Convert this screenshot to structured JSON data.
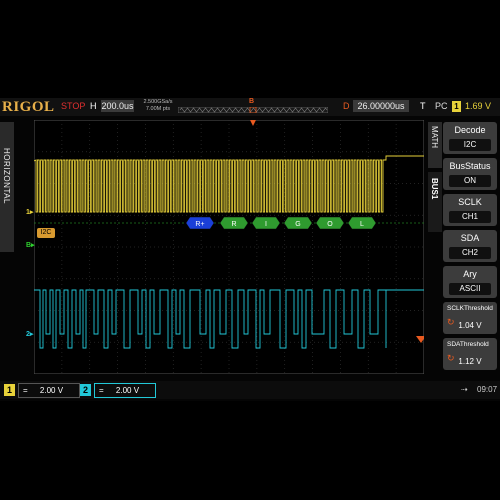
{
  "topbar": {
    "brand": "RIGOL",
    "run_state": "STOP",
    "h_label": "H",
    "timebase": "200.0us",
    "sample_rate": "2.500GSa/s",
    "mem_depth": "7.00M pts",
    "trigger_pos_marker": "B",
    "d_label": "D",
    "delay": "26.00000us",
    "t_label": "T",
    "trigger_coupling": "PC",
    "trigger_channel": "1",
    "trigger_level": "1.69 V"
  },
  "left_tab": {
    "label": "HORIZONTAL"
  },
  "decode": {
    "bus_label": "I2C",
    "packets": [
      "R+",
      "R",
      "I",
      "G",
      "O",
      "L"
    ],
    "colors": {
      "address": "#1a3fd8",
      "data": "#2f9b2f"
    }
  },
  "markers": {
    "ch1": "1",
    "ch2": "2",
    "bus": "B",
    "trigger": "T"
  },
  "right_menu": {
    "math_tab": "MATH",
    "bus_tab": "BUS1",
    "items": [
      {
        "title": "Decode",
        "value": "I2C"
      },
      {
        "title": "BusStatus",
        "value": "ON"
      },
      {
        "title": "SCLK",
        "value": "CH1"
      },
      {
        "title": "SDA",
        "value": "CH2"
      },
      {
        "title": "Ary",
        "value": "ASCII"
      },
      {
        "title": "SCLKThreshold",
        "value": "1.04 V"
      },
      {
        "title": "SDAThreshold",
        "value": "1.12 V"
      }
    ]
  },
  "bottombar": {
    "ch1": {
      "num": "1",
      "coupling": "=",
      "scale": "2.00 V",
      "color": "#e8d23a"
    },
    "ch2": {
      "num": "2",
      "coupling": "=",
      "scale": "2.00 V",
      "color": "#22c8d8"
    },
    "usb_icon": "usb-icon",
    "time": "09:07"
  },
  "colors": {
    "ch1": "#e8d23a",
    "ch2": "#22c8d8",
    "accent": "#e85a20",
    "grid": "#3a3a3a"
  }
}
